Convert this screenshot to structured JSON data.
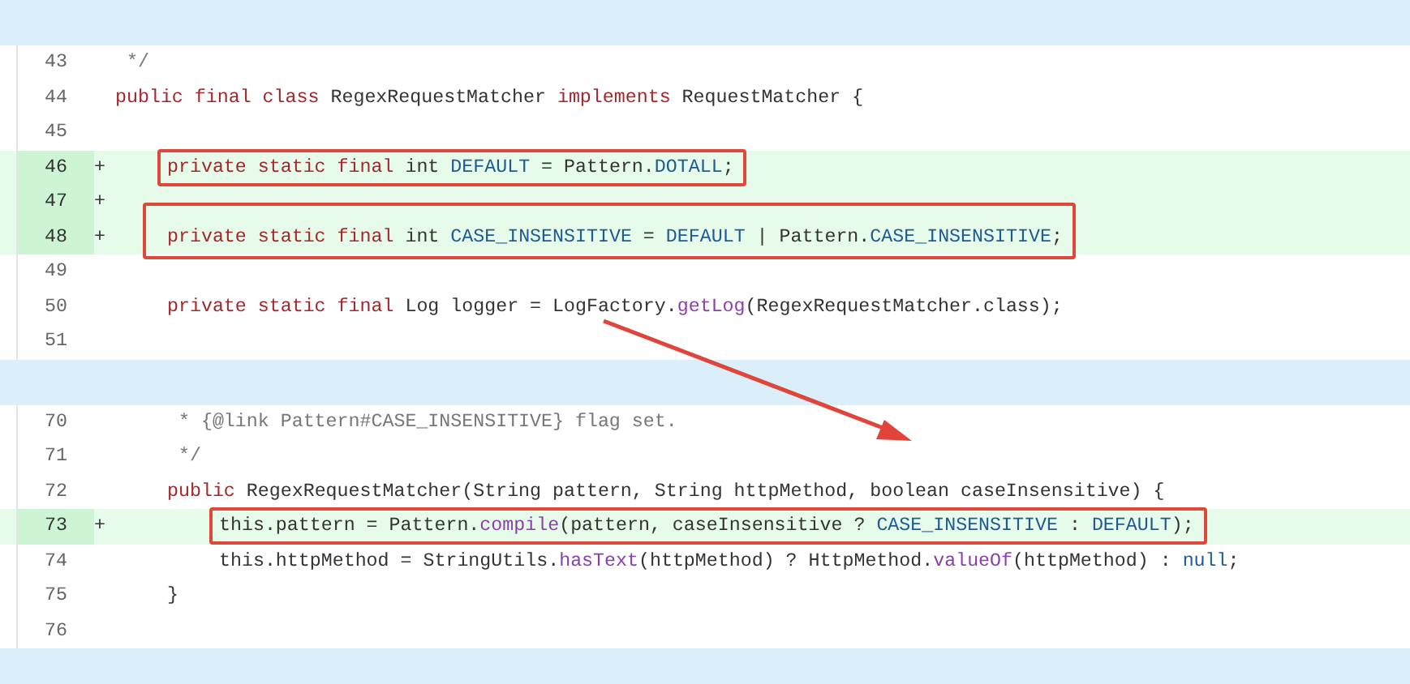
{
  "hunks": [
    {
      "lines": [
        {
          "number": "43",
          "added": false,
          "kind": "class",
          "segments": [
            {
              "kind": "comment",
              "text": " */"
            }
          ]
        },
        {
          "number": "44",
          "added": false,
          "kind": "class",
          "segments": [
            {
              "kind": "keyword",
              "text": "public final class"
            },
            {
              "kind": "plain",
              "text": " RegexRequestMatcher "
            },
            {
              "kind": "keyword",
              "text": "implements"
            },
            {
              "kind": "plain",
              "text": " RequestMatcher {"
            }
          ]
        },
        {
          "number": "45",
          "added": false
        },
        {
          "number": "46",
          "added": true,
          "marker": "+",
          "kind": "member",
          "highlighted": true,
          "segments": [
            {
              "kind": "keyword",
              "text": "private static final"
            },
            {
              "kind": "plain",
              "text": " int "
            },
            {
              "kind": "constant",
              "text": "DEFAULT"
            },
            {
              "kind": "plain",
              "text": " = Pattern."
            },
            {
              "kind": "constant",
              "text": "DOTALL"
            },
            {
              "kind": "plain",
              "text": ";"
            }
          ]
        },
        {
          "number": "47",
          "added": true,
          "marker": "+"
        },
        {
          "number": "48",
          "added": true,
          "marker": "+",
          "kind": "member",
          "segments": [
            {
              "kind": "keyword",
              "text": "private static final"
            },
            {
              "kind": "plain",
              "text": " int "
            },
            {
              "kind": "constant",
              "text": "CASE_INSENSITIVE"
            },
            {
              "kind": "plain",
              "text": " = "
            },
            {
              "kind": "constant",
              "text": "DEFAULT"
            },
            {
              "kind": "plain",
              "text": " | Pattern."
            },
            {
              "kind": "constant",
              "text": "CASE_INSENSITIVE"
            },
            {
              "kind": "plain",
              "text": ";"
            }
          ]
        },
        {
          "number": "49",
          "added": false
        },
        {
          "number": "50",
          "added": false,
          "kind": "member",
          "segments": [
            {
              "kind": "keyword",
              "text": "private static final"
            },
            {
              "kind": "plain",
              "text": " Log logger = LogFactory."
            },
            {
              "kind": "method",
              "text": "getLog"
            },
            {
              "kind": "plain",
              "text": "(RegexRequestMatcher.class);"
            }
          ]
        },
        {
          "number": "51",
          "added": false
        }
      ]
    },
    {
      "lines": [
        {
          "number": "70",
          "added": false,
          "kind": "member",
          "segments": [
            {
              "kind": "comment",
              "text": " * {@link Pattern#CASE_INSENSITIVE} flag set."
            }
          ]
        },
        {
          "number": "71",
          "added": false,
          "kind": "member",
          "segments": [
            {
              "kind": "comment",
              "text": " */"
            }
          ]
        },
        {
          "number": "72",
          "added": false,
          "kind": "member",
          "segments": [
            {
              "kind": "keyword",
              "text": "public"
            },
            {
              "kind": "plain",
              "text": " RegexRequestMatcher(String pattern, String httpMethod, boolean caseInsensitive) {"
            }
          ]
        },
        {
          "number": "73",
          "added": true,
          "marker": "+",
          "kind": "body",
          "highlighted": true,
          "segments": [
            {
              "kind": "plain",
              "text": "this.pattern = Pattern."
            },
            {
              "kind": "method",
              "text": "compile"
            },
            {
              "kind": "plain",
              "text": "(pattern, caseInsensitive ? "
            },
            {
              "kind": "constant",
              "text": "CASE_INSENSITIVE"
            },
            {
              "kind": "plain",
              "text": " : "
            },
            {
              "kind": "constant",
              "text": "DEFAULT"
            },
            {
              "kind": "plain",
              "text": ");"
            }
          ]
        },
        {
          "number": "74",
          "added": false,
          "kind": "body",
          "segments": [
            {
              "kind": "plain",
              "text": "this.httpMethod = StringUtils."
            },
            {
              "kind": "method",
              "text": "hasText"
            },
            {
              "kind": "plain",
              "text": "(httpMethod) ? HttpMethod."
            },
            {
              "kind": "method",
              "text": "valueOf"
            },
            {
              "kind": "plain",
              "text": "(httpMethod) : "
            },
            {
              "kind": "constant",
              "text": "null"
            },
            {
              "kind": "plain",
              "text": ";"
            }
          ]
        },
        {
          "number": "75",
          "added": false,
          "kind": "member",
          "segments": [
            {
              "kind": "plain",
              "text": "}"
            }
          ]
        },
        {
          "number": "76",
          "added": false
        }
      ]
    }
  ]
}
